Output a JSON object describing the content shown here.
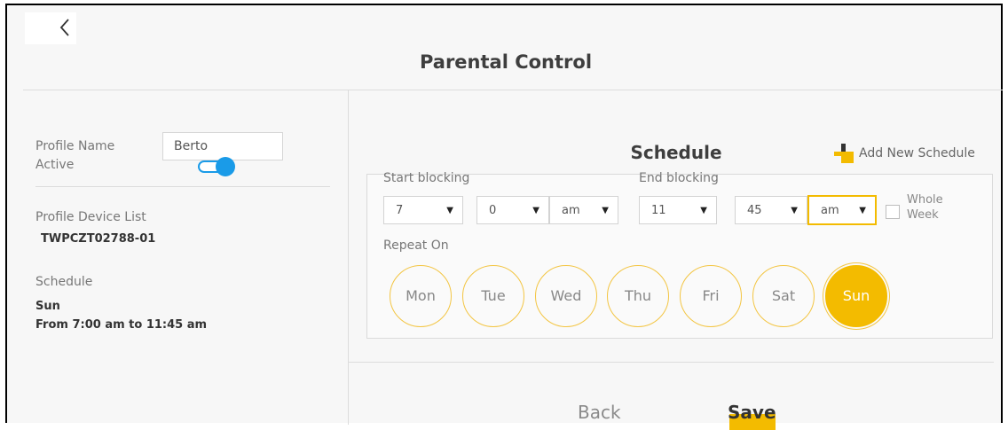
{
  "header": {
    "title": "Parental Control"
  },
  "profile": {
    "name_label": "Profile Name",
    "name_value": "Berto",
    "active_label": "Active",
    "device_list_label": "Profile Device List",
    "device": "TWPCZT02788-01",
    "schedule_label": "Schedule",
    "schedule_day": "Sun",
    "schedule_time": "From 7:00 am to 11:45 am"
  },
  "schedule": {
    "title": "Schedule",
    "add_label": "Add New Schedule",
    "start_label": "Start blocking",
    "end_label": "End blocking",
    "start_hour": "7",
    "start_minute": "0",
    "start_ampm": "am",
    "end_hour": "11",
    "end_minute": "45",
    "end_ampm": "am",
    "whole_week_line1": "Whole",
    "whole_week_line2": "Week",
    "whole_week_checked": false,
    "repeat_label": "Repeat On",
    "days": [
      "Mon",
      "Tue",
      "Wed",
      "Thu",
      "Fri",
      "Sat",
      "Sun"
    ],
    "selected_day": "Sun"
  },
  "footer": {
    "back_label": "Back",
    "save_label": "Save"
  },
  "colors": {
    "accent": "#f3bb00",
    "toggle": "#1a9be8",
    "background": "#f7f7f7"
  }
}
